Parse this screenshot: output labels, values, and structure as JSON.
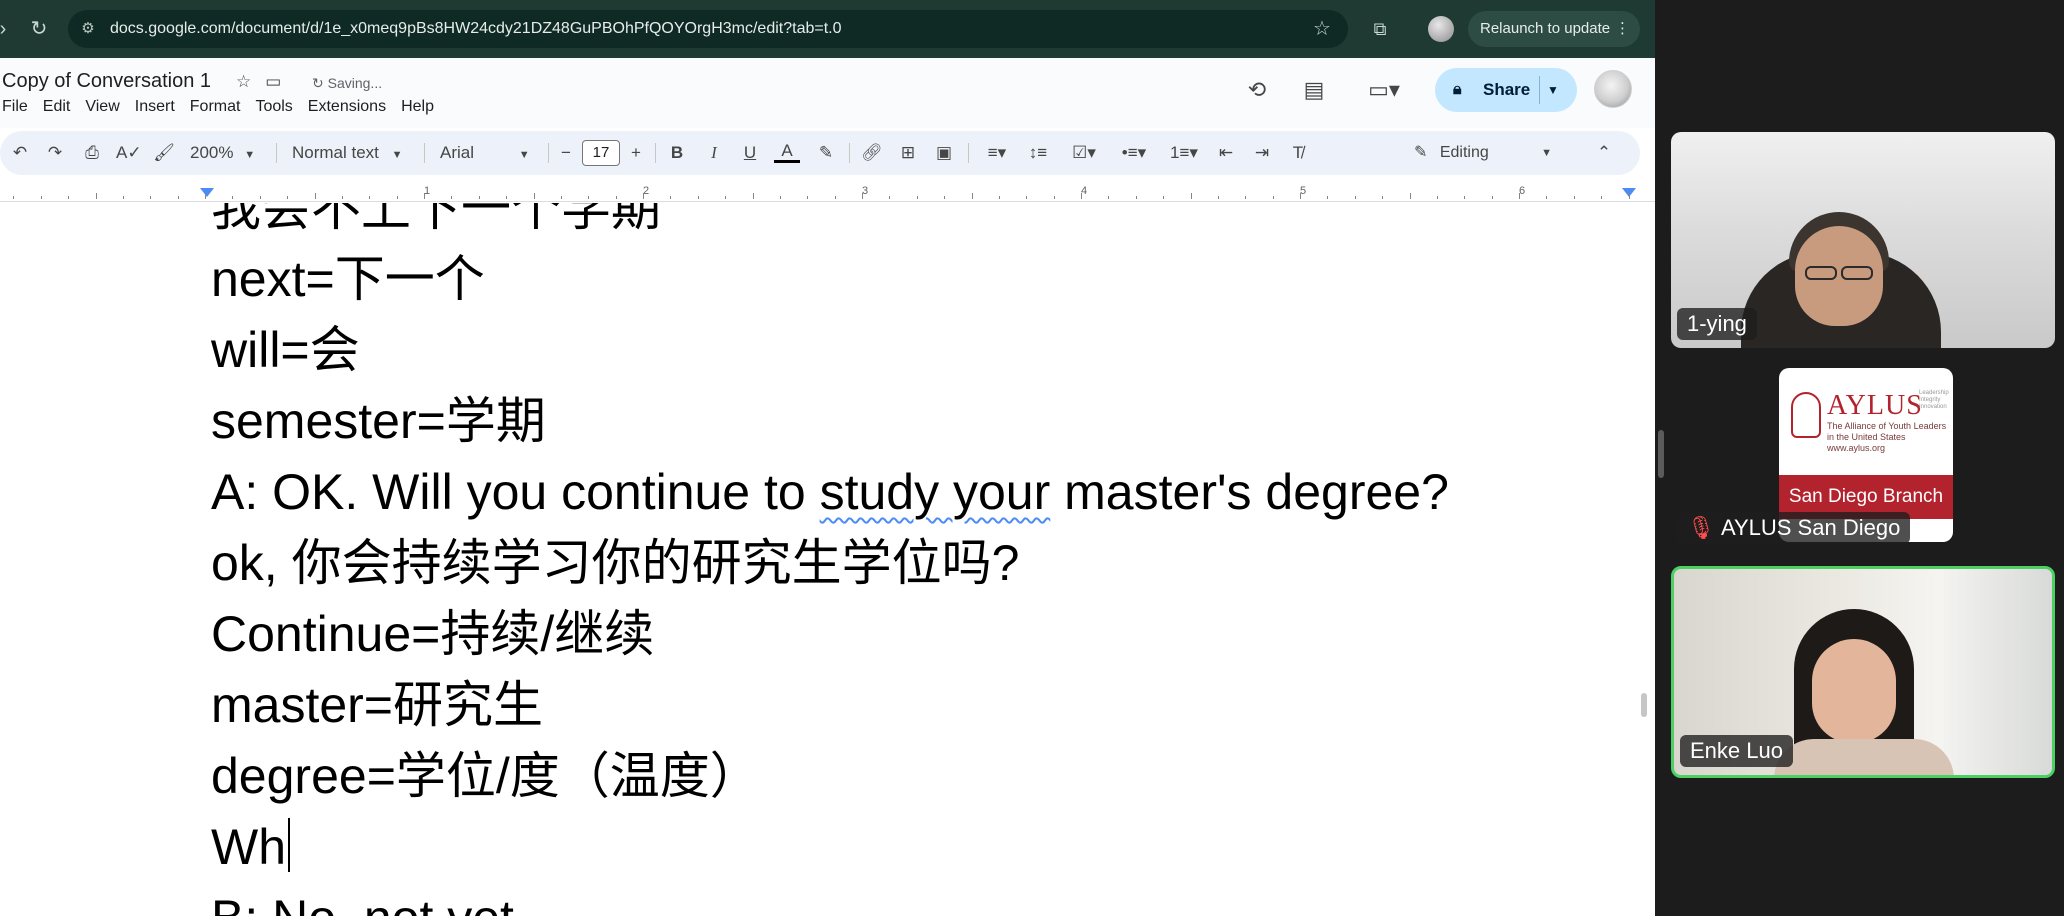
{
  "browser": {
    "url": "docs.google.com/document/d/1e_x0meq9pBs8HW24cdy21DZ48GuPBOhPfQOYOrgH3mc/edit?tab=t.0",
    "relaunch_label": "Relaunch to update"
  },
  "docs": {
    "title": "Copy of Conversation 1",
    "save_status": "Saving...",
    "menu": [
      "File",
      "Edit",
      "View",
      "Insert",
      "Format",
      "Tools",
      "Extensions",
      "Help"
    ],
    "share_label": "Share",
    "toolbar": {
      "zoom": "200%",
      "style": "Normal text",
      "font": "Arial",
      "font_size": "17",
      "mode": "Editing"
    },
    "ruler_numbers": [
      "1",
      "2",
      "3",
      "4",
      "5",
      "6"
    ],
    "lines": [
      "我会不上下一个学期",
      "next=下一个",
      "will=会",
      "semester=学期",
      "A: OK. Will you continue to ",
      "study your",
      " master's degree?",
      "ok,  你会持续学习你的研究生学位吗?",
      "Continue=持续/继续",
      "master=研究生",
      "degree=学位/度（温度）",
      "Wh",
      "B: No, not yet."
    ]
  },
  "meeting": {
    "participants": [
      {
        "name": "1-ying"
      },
      {
        "name": "AYLUS San Diego",
        "muted": true
      },
      {
        "name": "Enke Luo",
        "active_speaker": true
      }
    ],
    "aylus_card": {
      "logo": "AYLUS",
      "tagline": "The Alliance of Youth Leaders in the United States",
      "site": "www.aylus.org",
      "values": "Leadership Integrity Innovation",
      "branch": "San Diego Branch"
    },
    "colors": {
      "active_border": "#4bd061",
      "brand_red": "#b3232d",
      "muted_red": "#ff4d4d"
    }
  }
}
